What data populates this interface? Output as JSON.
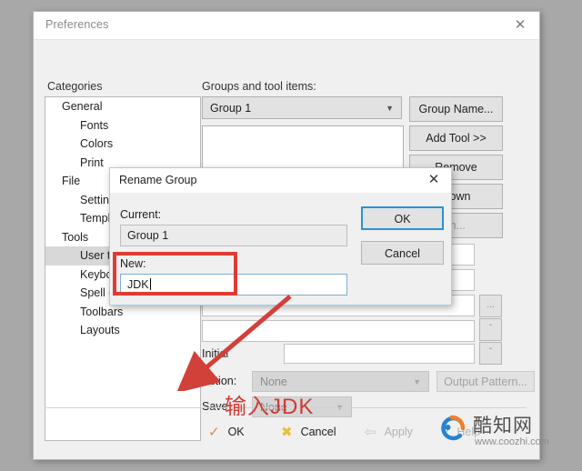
{
  "window": {
    "title": "Preferences",
    "close_icon": "close-icon"
  },
  "categories": {
    "label": "Categories",
    "items": [
      {
        "label": "General",
        "level": 0,
        "selected": false
      },
      {
        "label": "Fonts",
        "level": 1,
        "selected": false
      },
      {
        "label": "Colors",
        "level": 1,
        "selected": false
      },
      {
        "label": "Print",
        "level": 1,
        "selected": false
      },
      {
        "label": "File",
        "level": 0,
        "selected": false
      },
      {
        "label": "Settings",
        "level": 1,
        "selected": false
      },
      {
        "label": "Templates",
        "level": 1,
        "selected": false
      },
      {
        "label": "Tools",
        "level": 0,
        "selected": false
      },
      {
        "label": "User tools",
        "level": 1,
        "selected": true
      },
      {
        "label": "Keyboard",
        "level": 1,
        "selected": false
      },
      {
        "label": "Spell check",
        "level": 1,
        "selected": false
      },
      {
        "label": "Toolbars",
        "level": 1,
        "selected": false
      },
      {
        "label": "Layouts",
        "level": 1,
        "selected": false
      }
    ]
  },
  "groups_panel": {
    "label": "Groups and tool items:",
    "group_combo_value": "Group 1",
    "group_combo_chevron": "chevron-down-icon",
    "buttons": [
      {
        "label": "Group Name...",
        "dim": false
      },
      {
        "label": "Add Tool >>",
        "dim": false
      },
      {
        "label": "Remove",
        "dim": false
      },
      {
        "label": "Down",
        "dim": false
      },
      {
        "label": "m...",
        "dim": true
      }
    ],
    "rows": [
      {
        "label": "Initial",
        "value": ""
      }
    ],
    "mini_buttons": [
      {
        "glyph": "...",
        "name": "ellipsis-button"
      },
      {
        "glyph": "ˇ",
        "name": "chevron-down-button-1"
      },
      {
        "glyph": "ˇ",
        "name": "chevron-down-button-2"
      }
    ],
    "action_label": "Action:",
    "action_value": "None",
    "output_pattern_label": "Output Pattern...",
    "save_label": "Save",
    "save_value": "None"
  },
  "bottom_bar": {
    "ok": {
      "label": "OK",
      "glyph": "✓",
      "color": "#e08a3c"
    },
    "cancel": {
      "label": "Cancel",
      "glyph": "✖",
      "color": "#e8c03a"
    },
    "apply": {
      "label": "Apply",
      "glyph": "⇦",
      "color": "#b7d6b7"
    },
    "help": {
      "label": "Help",
      "glyph": "?",
      "color": "#b2b2b2"
    }
  },
  "modal": {
    "title": "Rename Group",
    "close_icon": "close-icon",
    "current_label": "Current:",
    "current_value": "Group 1",
    "new_label": "New:",
    "new_value": "JDK",
    "ok_label": "OK",
    "cancel_label": "Cancel"
  },
  "annotation": {
    "text": "输入JDK",
    "color": "#cf3b35"
  },
  "watermark": {
    "name_cn": "酷知网",
    "url": "www.coozhi.com"
  }
}
